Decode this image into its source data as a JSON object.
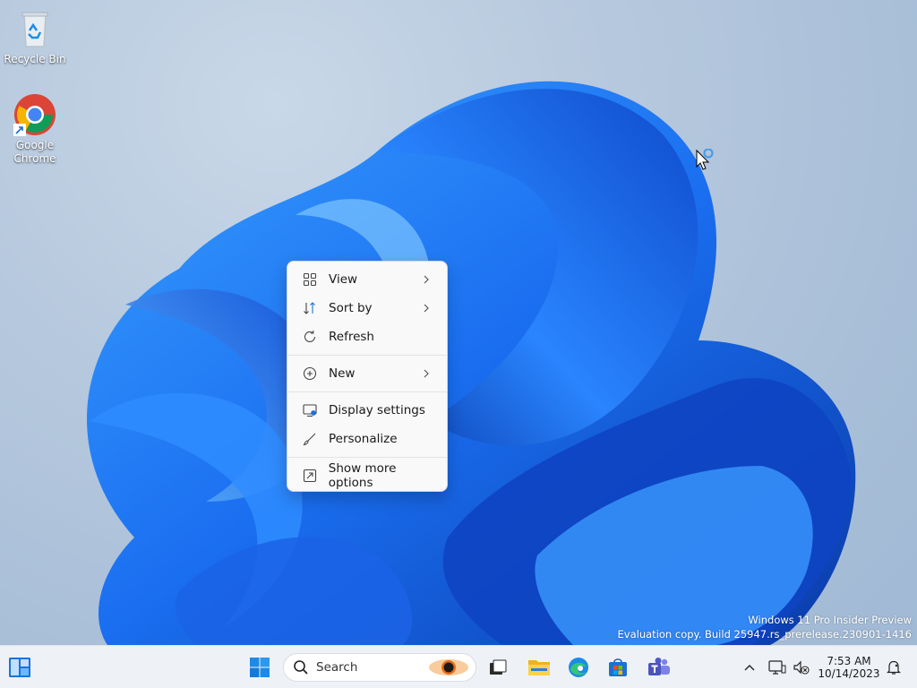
{
  "desktop": {
    "icons": [
      {
        "label": "Recycle Bin",
        "icon": "recycle-bin-icon"
      },
      {
        "label": "Google Chrome",
        "icon": "chrome-icon"
      }
    ],
    "watermark": {
      "line1": "Windows 11 Pro Insider Preview",
      "line2": "Evaluation copy. Build 25947.rs_prerelease.230901-1416"
    }
  },
  "context_menu": {
    "items": [
      {
        "label": "View",
        "icon": "view-grid-icon",
        "submenu": true
      },
      {
        "label": "Sort by",
        "icon": "sort-icon",
        "submenu": true
      },
      {
        "label": "Refresh",
        "icon": "refresh-icon",
        "submenu": false
      },
      {
        "label": "New",
        "icon": "new-plus-icon",
        "submenu": true
      },
      {
        "label": "Display settings",
        "icon": "display-settings-icon",
        "submenu": false
      },
      {
        "label": "Personalize",
        "icon": "personalize-brush-icon",
        "submenu": false
      },
      {
        "label": "Show more options",
        "icon": "show-more-options-icon",
        "submenu": false
      }
    ]
  },
  "taskbar": {
    "search_label": "Search",
    "pinned": [
      "widgets-icon",
      "start-icon",
      "task-view-icon",
      "file-explorer-icon",
      "edge-icon",
      "store-icon",
      "teams-icon"
    ],
    "tray": {
      "time": "7:53 AM",
      "date": "10/14/2023"
    }
  },
  "colors": {
    "accent": "#0067c0",
    "bloom_dark": "#0b3fb8",
    "bloom_light": "#2f8cff",
    "taskbar_bg": "#eef2f7",
    "menu_bg": "#f9f9f9"
  }
}
